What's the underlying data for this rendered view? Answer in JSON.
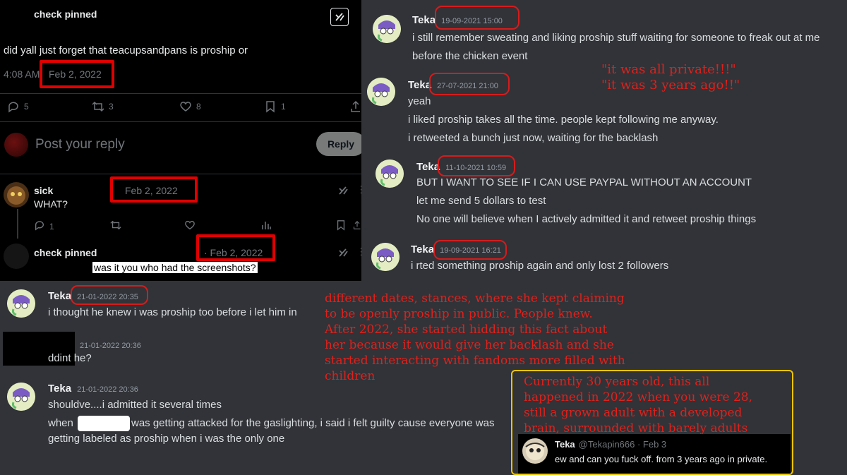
{
  "twitter": {
    "main_post": {
      "author": "check pinned",
      "text": "did yall just forget that teacupsandpans is proship or",
      "time": "4:08 AM",
      "date": "Feb 2, 2022",
      "replies": "5",
      "retweets": "3",
      "likes": "8",
      "bookmarks": "1"
    },
    "reply_box": {
      "placeholder": "Post your reply",
      "button": "Reply"
    },
    "reply1": {
      "author": "sick",
      "date": "Feb 2, 2022",
      "text": "WHAT?",
      "replies": "1"
    },
    "reply2": {
      "author": "check pinned",
      "date": "· Feb 2, 2022",
      "text": "was it you who had the screenshots?"
    }
  },
  "discord_right": {
    "messages": [
      {
        "author": "Teka",
        "time": "19-09-2021 15:00",
        "lines": [
          "i still remember sweating and liking proship stuff waiting for someone to freak out at me",
          "before the chicken event"
        ]
      },
      {
        "author": "Teka",
        "time": "27-07-2021 21:00",
        "lines": [
          "yeah",
          "i liked proship takes all the time. people kept following me anyway.",
          "i retweeted a bunch just now, waiting for the backlash"
        ]
      },
      {
        "author": "Teka",
        "time": "11-10-2021 10:59",
        "lines": [
          "BUT I WANT TO SEE IF I CAN USE PAYPAL WITHOUT AN ACCOUNT",
          "let me send 5 dollars to test",
          "No one will believe when I actively admitted it and retweet proship things"
        ]
      },
      {
        "author": "Teka",
        "time": "19-09-2021 16:21",
        "lines": [
          "i rted something proship again and only lost 2 followers"
        ]
      }
    ],
    "annotation": [
      "\"it was all private!!!\"",
      "\"it was 3 years ago!!\""
    ]
  },
  "discord_bottom": {
    "messages": [
      {
        "author": "Teka",
        "time": "21-01-2022 20:35",
        "lines": [
          "i thought he knew i was proship too before i let him in"
        ]
      },
      {
        "author": "",
        "time": "21-01-2022 20:36",
        "lines": [
          "ddint he?"
        ]
      },
      {
        "author": "Teka",
        "time": "21-01-2022 20:36",
        "lines": [
          "shouldve....i admitted it several times",
          "when",
          "was getting attacked for the gaslighting, i said i felt guilty cause everyone was",
          "getting labeled as proship when i was the only one"
        ]
      }
    ],
    "annotation_main": [
      "different dates, stances, where she kept claiming",
      "to be openly proship in public. People knew.",
      "After 2022, she started hidding this fact about",
      "her because it would give her backlash and she",
      "started interacting with fandoms more filled with",
      "children"
    ],
    "annotation_box": [
      "Currently 30 years old, this all",
      "happened in 2022 when you were 28,",
      "still a grown adult with a developed",
      "brain, surrounded with barely adults"
    ],
    "embed": {
      "name": "Teka",
      "handle": "@Tekapin666 · Feb 3",
      "text": "ew and can you fuck off. from 3 years ago in private."
    }
  },
  "colors": {
    "highlight_red": "#e00000",
    "annotation_red": "#e0211b",
    "frame_yellow": "#f0c400",
    "discord_bg": "#313338",
    "twitter_bg": "#000000"
  }
}
